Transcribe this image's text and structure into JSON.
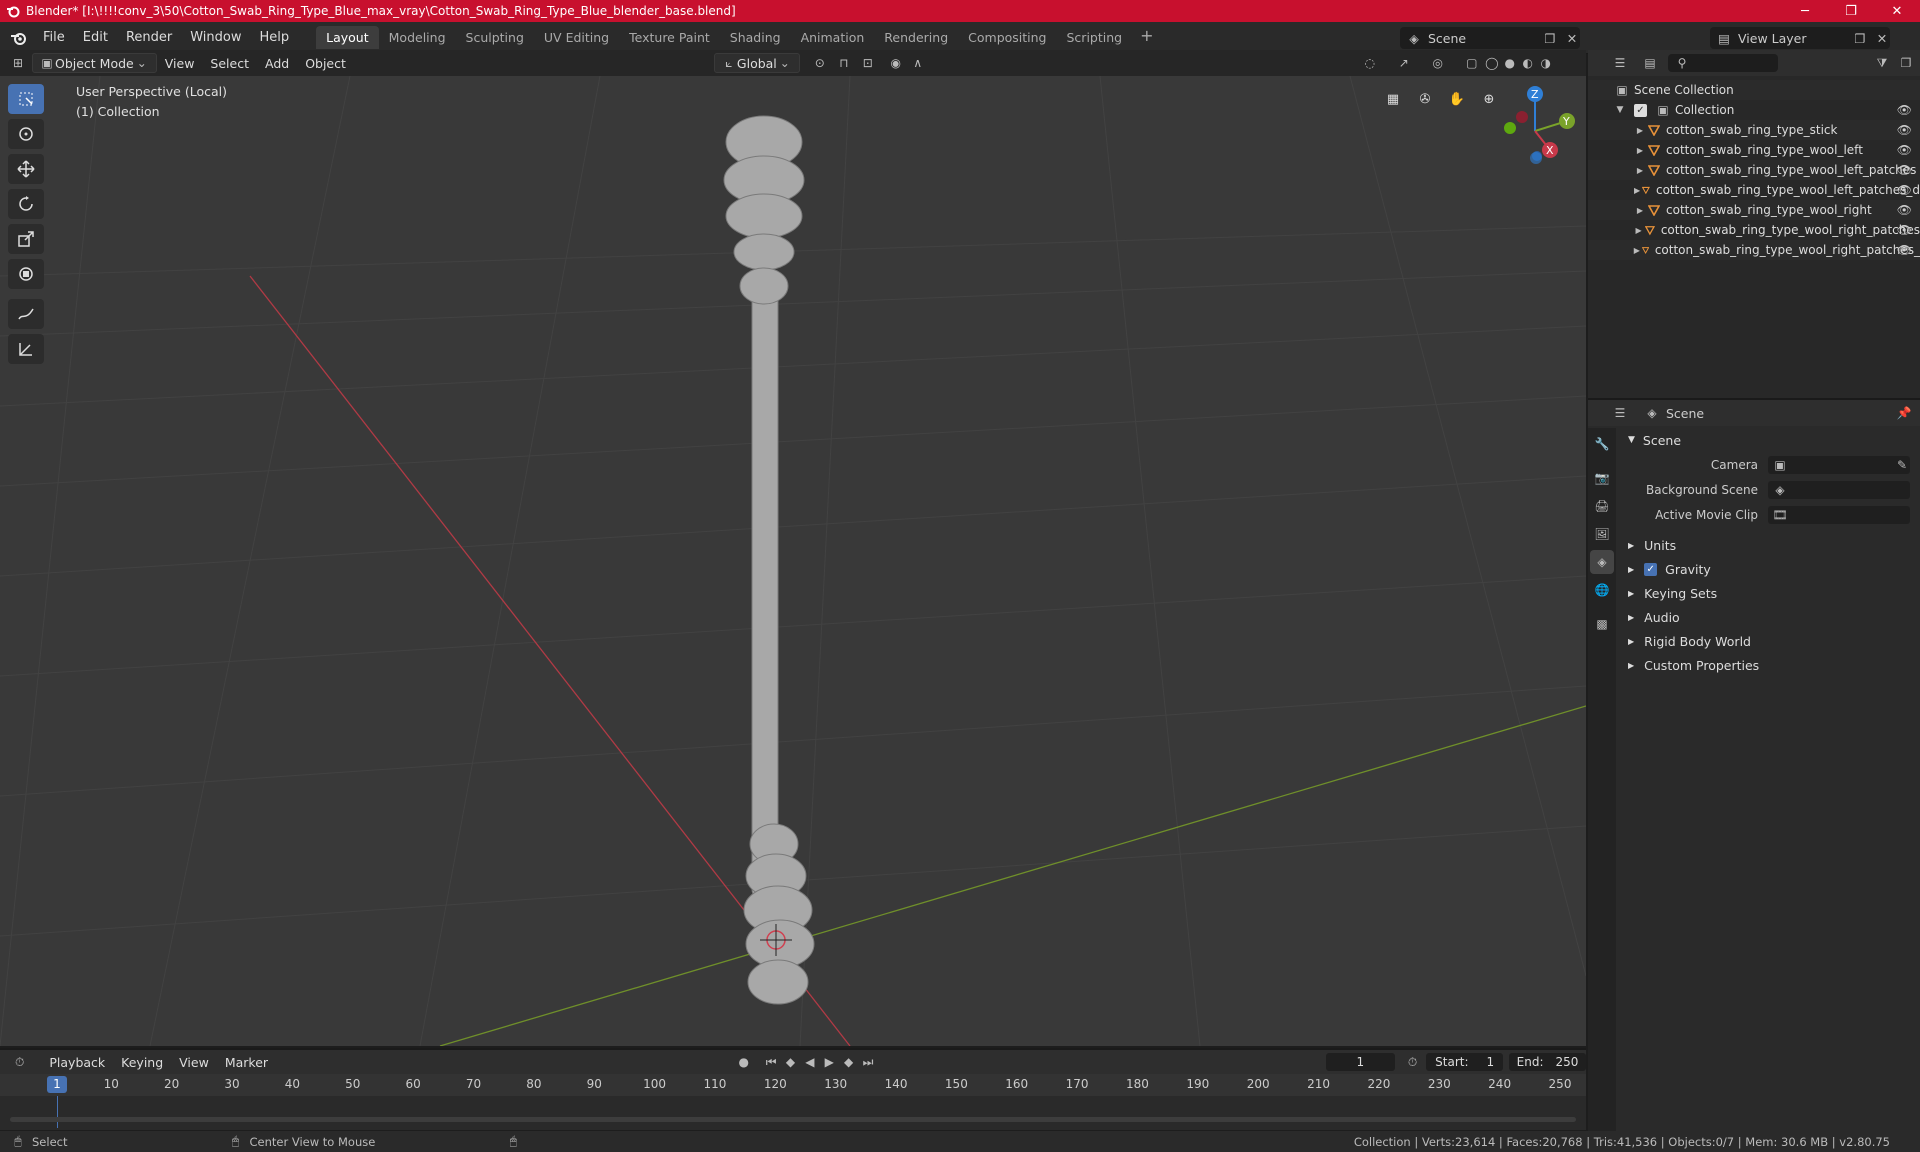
{
  "titlebar": {
    "title": "Blender* [I:\\!!!!conv_3\\50\\Cotton_Swab_Ring_Type_Blue_max_vray\\Cotton_Swab_Ring_Type_Blue_blender_base.blend]",
    "minimize": "─",
    "maximize": "❐",
    "close": "✕"
  },
  "menubar": {
    "items": [
      "File",
      "Edit",
      "Render",
      "Window",
      "Help"
    ],
    "workspaces": [
      "Layout",
      "Modeling",
      "Sculpting",
      "UV Editing",
      "Texture Paint",
      "Shading",
      "Animation",
      "Rendering",
      "Compositing",
      "Scripting"
    ],
    "active_workspace": "Layout",
    "add_tab": "+",
    "scene": "Scene",
    "view_layer": "View Layer"
  },
  "viewport_header": {
    "mode": "Object Mode",
    "menus": [
      "View",
      "Select",
      "Add",
      "Object"
    ],
    "orientation": "Global"
  },
  "viewport": {
    "perspective_label": "User Perspective (Local)",
    "collection_label": "(1) Collection",
    "gizmo": {
      "z": "Z",
      "y": "Y",
      "x": "X"
    }
  },
  "outliner": {
    "root": "Scene Collection",
    "collection": "Collection",
    "objects": [
      "cotton_swab_ring_type_stick",
      "cotton_swab_ring_type_wool_left",
      "cotton_swab_ring_type_wool_left_patches",
      "cotton_swab_ring_type_wool_left_patches_d",
      "cotton_swab_ring_type_wool_right",
      "cotton_swab_ring_type_wool_right_patches",
      "cotton_swab_ring_type_wool_right_patches_"
    ]
  },
  "properties": {
    "context": "Scene",
    "panel": "Scene",
    "fields": {
      "camera": "Camera",
      "background_scene": "Background Scene",
      "active_movie_clip": "Active Movie Clip"
    },
    "subpanels": [
      "Units",
      "Gravity",
      "Keying Sets",
      "Audio",
      "Rigid Body World",
      "Custom Properties"
    ]
  },
  "timeline": {
    "menus": [
      "Playback",
      "Keying",
      "View",
      "Marker"
    ],
    "current_frame": "1",
    "start_label": "Start:",
    "start_value": "1",
    "end_label": "End:",
    "end_value": "250",
    "ticks": [
      "1",
      "10",
      "20",
      "30",
      "40",
      "50",
      "60",
      "70",
      "80",
      "90",
      "100",
      "110",
      "120",
      "130",
      "140",
      "150",
      "160",
      "170",
      "180",
      "190",
      "200",
      "210",
      "220",
      "230",
      "240",
      "250"
    ]
  },
  "statusbar": {
    "select": "Select",
    "center_view": "Center View to Mouse",
    "stats": "Collection | Verts:23,614 | Faces:20,768 | Tris:41,536 | Objects:0/7 | Mem: 30.6 MB | v2.80.75"
  },
  "colors": {
    "accent": "#4772b3",
    "titlebar": "#c8102e",
    "x_axis": "#c8394a",
    "y_axis": "#7aa32a",
    "z_axis": "#2f7fd6",
    "object_orange": "#e8923a"
  }
}
